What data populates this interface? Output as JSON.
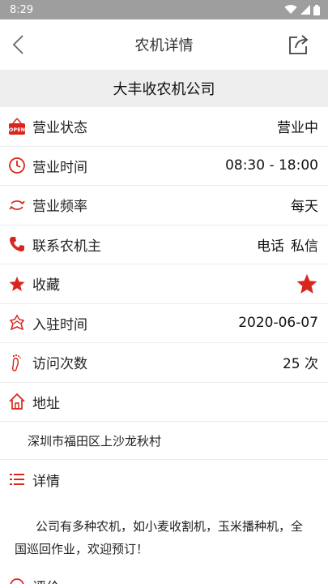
{
  "status_bar": {
    "time": "8:29"
  },
  "header": {
    "title": "农机详情"
  },
  "company": {
    "name": "大丰收农机公司"
  },
  "info_rows": {
    "status": {
      "label": "营业状态",
      "value": "营业中"
    },
    "hours": {
      "label": "营业时间",
      "value": "08:30 - 18:00"
    },
    "frequency": {
      "label": "营业频率",
      "value": "每天"
    },
    "contact": {
      "label": "联系农机主",
      "phone": "电话",
      "message": "私信"
    },
    "favorite": {
      "label": "收藏"
    },
    "joined": {
      "label": "入驻时间",
      "value": "2020-06-07"
    },
    "visits": {
      "label": "访问次数",
      "value": "25 次"
    },
    "address": {
      "label": "地址",
      "value": "深圳市福田区上沙龙秋村"
    }
  },
  "details": {
    "label": "详情",
    "text": "公司有多种农机，如小麦收割机，玉米播种机，全国巡回作业，欢迎预订！"
  },
  "next_section": {
    "label": "评价"
  },
  "colors": {
    "accent": "#d9251c",
    "status_bar": "#9e9e9e",
    "company_bar": "#eeeeee"
  },
  "icons": [
    "back-icon",
    "share-icon",
    "open-sign-icon",
    "clock-icon",
    "cycle-icon",
    "phone-icon",
    "star-icon",
    "handshake-icon",
    "footprint-icon",
    "home-icon",
    "list-icon"
  ]
}
